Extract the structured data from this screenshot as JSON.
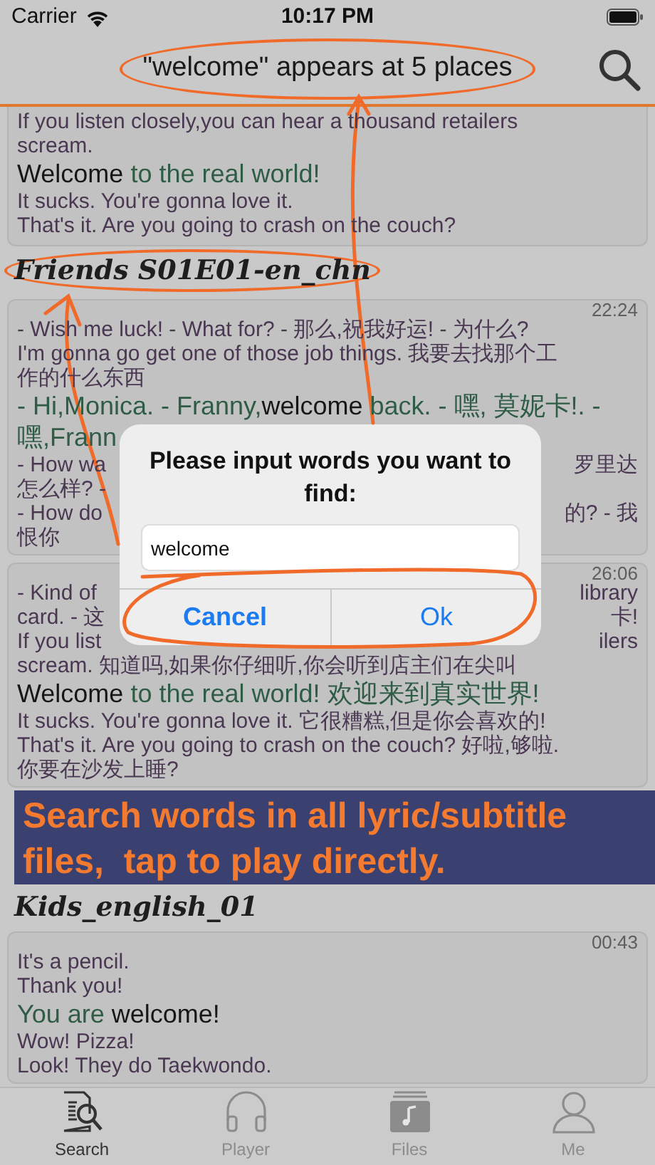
{
  "status_bar": {
    "carrier": "Carrier",
    "time": "10:17 PM"
  },
  "header": {
    "title": "\"welcome\" appears at 5 places",
    "circled": true
  },
  "items": [
    {
      "kind": "card",
      "clipped": true,
      "rows": [
        {
          "kind": "line",
          "text": "If you listen closely,you can hear a thousand retailers"
        },
        {
          "kind": "line",
          "text": "scream."
        },
        {
          "kind": "match",
          "segments": [
            {
              "text": "Welcome",
              "kind": "match"
            },
            {
              "text": " to the real world!",
              "kind": "context"
            }
          ]
        },
        {
          "kind": "line",
          "text": "It sucks. You're gonna love it."
        },
        {
          "kind": "line",
          "text": "That's it. Are you going to crash on the couch?"
        }
      ]
    },
    {
      "kind": "heading",
      "text": "Friends S01E01-en_chn",
      "circled": true
    },
    {
      "kind": "card",
      "clipped": false,
      "time": "22:24",
      "rows": [
        {
          "kind": "line",
          "text": "- Wish me luck! - What for? - 那么,祝我好运! - 为什么?"
        },
        {
          "kind": "line",
          "text": "I'm gonna go get one of those job things. 我要去找那个工"
        },
        {
          "kind": "line",
          "text": "作的什么东西"
        },
        {
          "kind": "match",
          "segments": [
            {
              "text": "- Hi,Monica. - Franny,",
              "kind": "context"
            },
            {
              "text": "welcome",
              "kind": "match"
            },
            {
              "text": " back. - 嘿, 莫妮卡!. -",
              "kind": "context"
            }
          ]
        },
        {
          "kind": "match",
          "segments": [
            {
              "text": "嘿,Frann",
              "kind": "context"
            }
          ]
        },
        {
          "kind": "split",
          "left": "- How wa",
          "right": "罗里达"
        },
        {
          "kind": "split",
          "left": "怎么样? -"
        },
        {
          "kind": "split",
          "left": "- How do",
          "right": "的? - 我"
        },
        {
          "kind": "line",
          "text": "恨你"
        }
      ]
    },
    {
      "kind": "card",
      "clipped": false,
      "time": "26:06",
      "rows": [
        {
          "kind": "split",
          "left": "- Kind of",
          "right": "library"
        },
        {
          "kind": "split",
          "left": "card. - 这",
          "right": "卡!"
        },
        {
          "kind": "split",
          "left": "If you list",
          "right": "ilers"
        },
        {
          "kind": "line",
          "text": "scream. 知道吗,如果你仔细听,你会听到店主们在尖叫"
        },
        {
          "kind": "match",
          "segments": [
            {
              "text": "Welcome",
              "kind": "match"
            },
            {
              "text": " to the real world! 欢迎来到真实世界!",
              "kind": "context"
            }
          ]
        },
        {
          "kind": "line",
          "text": "It sucks. You're gonna love it. 它很糟糕,但是你会喜欢的!"
        },
        {
          "kind": "line",
          "text": "That's it. Are you going to crash on the couch? 好啦,够啦."
        },
        {
          "kind": "line",
          "text": "你要在沙发上睡?"
        }
      ]
    },
    {
      "kind": "banner",
      "text": "Search words in all lyric/subtitle files,  tap to play directly."
    },
    {
      "kind": "heading",
      "text": "Kids_english_01",
      "circled": false
    },
    {
      "kind": "card",
      "clipped": false,
      "time": "00:43",
      "rows": [
        {
          "kind": "line",
          "text": "It's a pencil."
        },
        {
          "kind": "line",
          "text": "Thank you!"
        },
        {
          "kind": "match",
          "segments": [
            {
              "text": "You are ",
              "kind": "context"
            },
            {
              "text": "welcome!",
              "kind": "match"
            }
          ]
        },
        {
          "kind": "line",
          "text": "Wow! Pizza!"
        },
        {
          "kind": "line",
          "text": "Look! They do Taekwondo."
        }
      ]
    }
  ],
  "dialog": {
    "title": "Please input words you want to find:",
    "input_value": "welcome",
    "buttons": [
      {
        "label": "Cancel",
        "kind": "cancel"
      },
      {
        "label": "Ok",
        "kind": "ok"
      }
    ]
  },
  "tabs": [
    {
      "label": "Search",
      "selected": true
    },
    {
      "label": "Player",
      "selected": false
    },
    {
      "label": "Files",
      "selected": false
    },
    {
      "label": "Me",
      "selected": false
    }
  ]
}
